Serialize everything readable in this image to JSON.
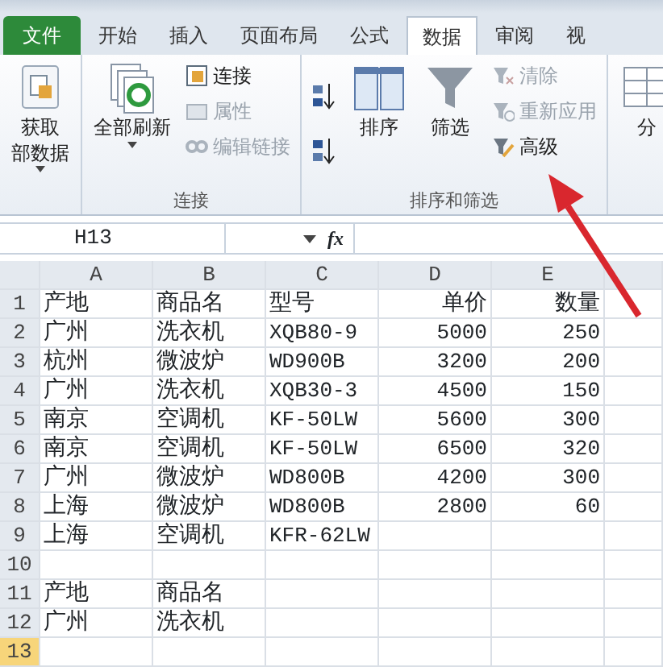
{
  "tabs": [
    {
      "label": "文件",
      "kind": "file",
      "selected": false
    },
    {
      "label": "开始",
      "kind": "tab",
      "selected": false
    },
    {
      "label": "插入",
      "kind": "tab",
      "selected": false
    },
    {
      "label": "页面布局",
      "kind": "tab",
      "selected": false
    },
    {
      "label": "公式",
      "kind": "tab",
      "selected": false
    },
    {
      "label": "数据",
      "kind": "tab",
      "selected": true
    },
    {
      "label": "审阅",
      "kind": "tab",
      "selected": false
    },
    {
      "label": "视",
      "kind": "tab",
      "selected": false
    }
  ],
  "ribbon_groups": [
    {
      "items": [
        {
          "kind": "large",
          "lines": [
            "获取",
            "部数据"
          ],
          "dropdown": true
        }
      ]
    },
    {
      "label": "连接",
      "items": [
        {
          "kind": "large",
          "label": "全部刷新",
          "dropdown": true
        },
        {
          "kind": "stack",
          "buttons": [
            {
              "label": "连接",
              "disabled": false
            },
            {
              "label": "属性",
              "disabled": true
            },
            {
              "label": "编辑链接",
              "disabled": true
            }
          ]
        }
      ]
    },
    {
      "label": "排序和筛选",
      "items": [
        {
          "kind": "sortpair"
        },
        {
          "kind": "large",
          "label": "排序"
        },
        {
          "kind": "large",
          "label": "筛选"
        },
        {
          "kind": "stack",
          "buttons": [
            {
              "label": "清除",
              "disabled": true
            },
            {
              "label": "重新应用",
              "disabled": true
            },
            {
              "label": "高级",
              "disabled": false
            }
          ]
        }
      ]
    },
    {
      "items": [
        {
          "kind": "large",
          "label": "分"
        }
      ]
    }
  ],
  "name_box": "H13",
  "formula_label": "fx",
  "columns": [
    "A",
    "B",
    "C",
    "D",
    "E"
  ],
  "rows": [
    {
      "number": "1",
      "selected": false,
      "cells": [
        "产地",
        "商品名",
        "型号",
        "单价",
        "数量"
      ]
    },
    {
      "number": "2",
      "selected": false,
      "cells": [
        "广州",
        "洗衣机",
        "XQB80-9",
        "5000",
        "250"
      ]
    },
    {
      "number": "3",
      "selected": false,
      "cells": [
        "杭州",
        "微波炉",
        "WD900B",
        "3200",
        "200"
      ]
    },
    {
      "number": "4",
      "selected": false,
      "cells": [
        "广州",
        "洗衣机",
        "XQB30-3",
        "4500",
        "150"
      ]
    },
    {
      "number": "5",
      "selected": false,
      "cells": [
        "南京",
        "空调机",
        "KF-50LW",
        "5600",
        "300"
      ]
    },
    {
      "number": "6",
      "selected": false,
      "cells": [
        "南京",
        "空调机",
        "KF-50LW",
        "6500",
        "320"
      ]
    },
    {
      "number": "7",
      "selected": false,
      "cells": [
        "广州",
        "微波炉",
        "WD800B",
        "4200",
        "300"
      ]
    },
    {
      "number": "8",
      "selected": false,
      "cells": [
        "上海",
        "微波炉",
        "WD800B",
        "2800",
        "60"
      ]
    },
    {
      "number": "9",
      "selected": false,
      "cells": [
        "上海",
        "空调机",
        "KFR-62LW",
        "",
        ""
      ]
    },
    {
      "number": "10",
      "selected": false,
      "cells": [
        "",
        "",
        "",
        "",
        ""
      ]
    },
    {
      "number": "11",
      "selected": false,
      "cells": [
        "产地",
        "商品名",
        "",
        "",
        ""
      ]
    },
    {
      "number": "12",
      "selected": false,
      "cells": [
        "广州",
        "洗衣机",
        "",
        "",
        ""
      ]
    },
    {
      "number": "13",
      "selected": true,
      "cells": [
        "",
        "",
        "",
        "",
        ""
      ]
    }
  ]
}
